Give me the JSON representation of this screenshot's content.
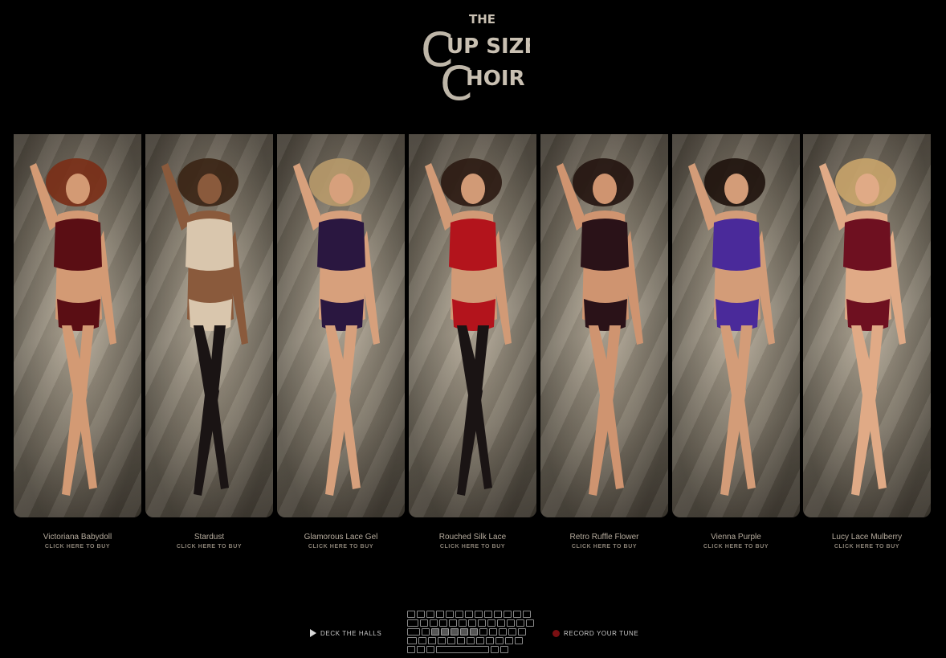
{
  "logo": {
    "line1": "THE",
    "line2": "UP SIZE",
    "line3": "HOIR",
    "big_letter": "C"
  },
  "products": [
    {
      "name": "Victoriana Babydoll",
      "cta": "CLICK HERE TO BUY",
      "garment_color": "#5a0e14",
      "skin_color": "#d39a74",
      "hair_color": "#7a2e16",
      "legwear": "none"
    },
    {
      "name": "Stardust",
      "cta": "CLICK HERE TO BUY",
      "garment_color": "#d9c6ad",
      "skin_color": "#8a5a3c",
      "hair_color": "#3a2414",
      "legwear": "black"
    },
    {
      "name": "Glamorous Lace Gel",
      "cta": "CLICK HERE TO BUY",
      "garment_color": "#2a1740",
      "skin_color": "#d7a07c",
      "hair_color": "#b89a6a",
      "legwear": "none"
    },
    {
      "name": "Rouched Silk Lace",
      "cta": "CLICK HERE TO BUY",
      "garment_color": "#b3141c",
      "skin_color": "#d19a76",
      "hair_color": "#2b1a12",
      "legwear": "black"
    },
    {
      "name": "Retro Ruffle Flower",
      "cta": "CLICK HERE TO BUY",
      "garment_color": "#2a1218",
      "skin_color": "#cf9470",
      "hair_color": "#241410",
      "legwear": "none"
    },
    {
      "name": "Vienna Purple",
      "cta": "CLICK HERE TO BUY",
      "garment_color": "#4a2a9a",
      "skin_color": "#d39c78",
      "hair_color": "#1e120c",
      "legwear": "none"
    },
    {
      "name": "Lucy Lace Mulberry",
      "cta": "CLICK HERE TO BUY",
      "garment_color": "#6e1020",
      "skin_color": "#e0aa86",
      "hair_color": "#c9a46a",
      "legwear": "none"
    }
  ],
  "controls": {
    "deck_label": "DECK THE HALLS",
    "record_label": "RECORD YOUR TUNE",
    "record_color": "#7a0f12"
  }
}
